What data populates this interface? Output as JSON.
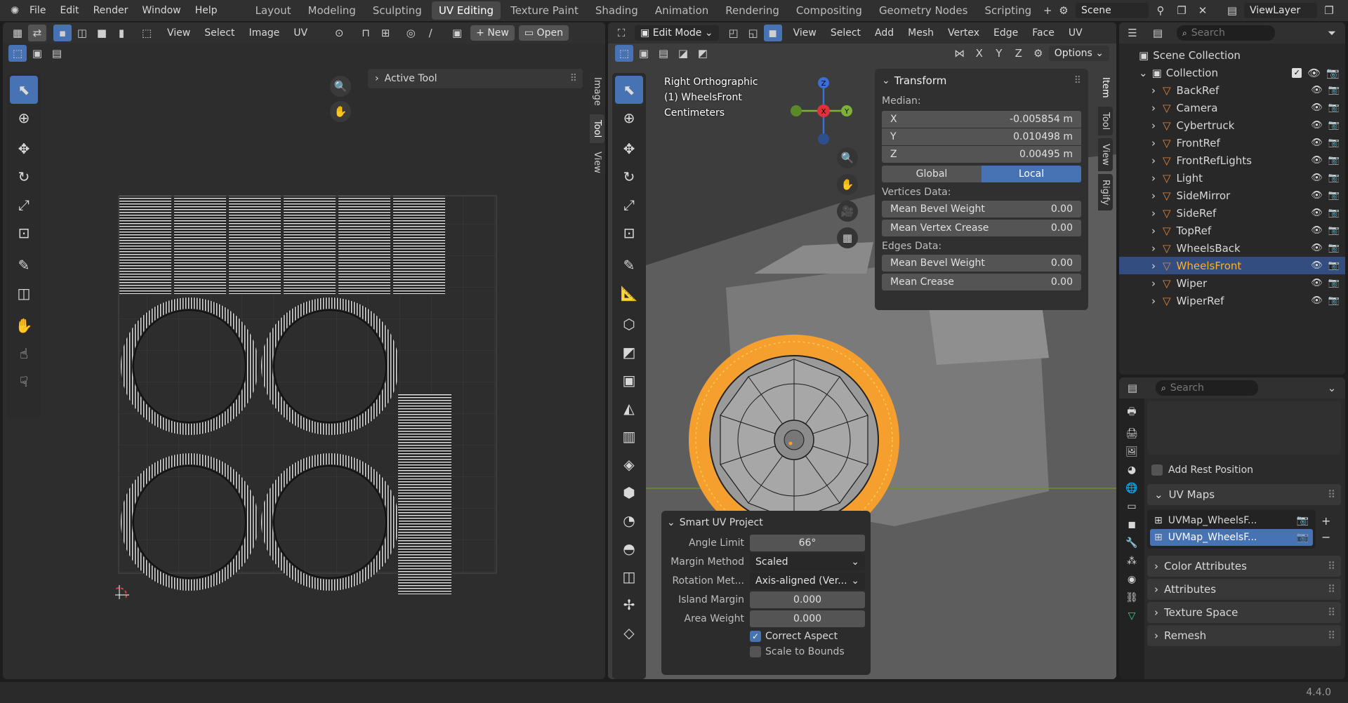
{
  "topbar": {
    "menus": [
      "File",
      "Edit",
      "Render",
      "Window",
      "Help"
    ],
    "workspaces": [
      "Layout",
      "Modeling",
      "Sculpting",
      "UV Editing",
      "Texture Paint",
      "Shading",
      "Animation",
      "Rendering",
      "Compositing",
      "Geometry Nodes",
      "Scripting"
    ],
    "active_workspace": "UV Editing",
    "scene": "Scene",
    "viewlayer": "ViewLayer"
  },
  "uv_editor": {
    "menus": [
      "View",
      "Select",
      "Image",
      "UV"
    ],
    "new_label": "New",
    "open_label": "Open",
    "active_tool_label": "Active Tool",
    "tabs": [
      "Image",
      "Tool",
      "View"
    ]
  },
  "viewport": {
    "mode": "Edit Mode",
    "menus": [
      "View",
      "Select",
      "Add",
      "Mesh",
      "Vertex",
      "Edge",
      "Face",
      "UV"
    ],
    "options_label": "Options",
    "axis_x": "X",
    "axis_y": "Y",
    "axis_z": "Z",
    "info": [
      "Right Orthographic",
      "(1) WheelsFront",
      "Centimeters"
    ],
    "tabs": [
      "Item",
      "Tool",
      "View",
      "Rigify"
    ]
  },
  "transform": {
    "title": "Transform",
    "median_label": "Median:",
    "x_label": "X",
    "x": "-0.005854 m",
    "y_label": "Y",
    "y": "0.010498 m",
    "z_label": "Z",
    "z": "0.00495 m",
    "global": "Global",
    "local": "Local",
    "vertices_label": "Vertices Data:",
    "mean_bevel_weight_label": "Mean Bevel Weight",
    "mean_bevel_weight": "0.00",
    "mean_vertex_crease_label": "Mean Vertex Crease",
    "mean_vertex_crease": "0.00",
    "edges_label": "Edges Data:",
    "edge_bevel_label": "Mean Bevel Weight",
    "edge_bevel": "0.00",
    "mean_crease_label": "Mean Crease",
    "mean_crease": "0.00"
  },
  "smart_uv": {
    "title": "Smart UV Project",
    "angle_limit_label": "Angle Limit",
    "angle_limit": "66°",
    "margin_method_label": "Margin Method",
    "margin_method": "Scaled",
    "rotation_label": "Rotation Met...",
    "rotation": "Axis-aligned (Ver...",
    "island_margin_label": "Island Margin",
    "island_margin": "0.000",
    "area_weight_label": "Area Weight",
    "area_weight": "0.000",
    "correct_aspect": "Correct Aspect",
    "scale_bounds": "Scale to Bounds"
  },
  "outliner": {
    "search_placeholder": "Search",
    "scene_collection": "Scene Collection",
    "collection": "Collection",
    "items": [
      {
        "name": "BackRef",
        "selected": false
      },
      {
        "name": "Camera",
        "selected": false
      },
      {
        "name": "Cybertruck",
        "selected": false
      },
      {
        "name": "FrontRef",
        "selected": false
      },
      {
        "name": "FrontRefLights",
        "selected": false
      },
      {
        "name": "Light",
        "selected": false
      },
      {
        "name": "SideMirror",
        "selected": false
      },
      {
        "name": "SideRef",
        "selected": false
      },
      {
        "name": "TopRef",
        "selected": false
      },
      {
        "name": "WheelsBack",
        "selected": false
      },
      {
        "name": "WheelsFront",
        "selected": true
      },
      {
        "name": "Wiper",
        "selected": false
      },
      {
        "name": "WiperRef",
        "selected": false
      }
    ]
  },
  "properties": {
    "search_placeholder": "Search",
    "add_rest_position": "Add Rest Position",
    "uv_maps_label": "UV Maps",
    "uv_maps": [
      "UVMap_WheelsF...",
      "UVMap_WheelsF..."
    ],
    "sections": [
      "Color Attributes",
      "Attributes",
      "Texture Space",
      "Remesh"
    ]
  },
  "statusbar": {
    "version": "4.4.0"
  },
  "colors": {
    "accent": "#4772b3",
    "selection_orange": "#f5a02e",
    "outliner_name_selected": "#ffaf29"
  }
}
